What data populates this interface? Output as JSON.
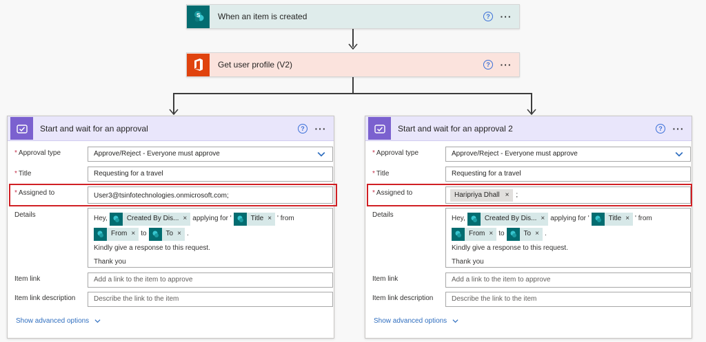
{
  "trigger": {
    "title": "When an item is created",
    "icon": "sharepoint-icon",
    "bg": "#dfeceb"
  },
  "profile": {
    "title": "Get user profile (V2)",
    "icon": "office-icon",
    "bg": "#fbe3dd"
  },
  "common": {
    "help": "?",
    "more": "···"
  },
  "left": {
    "title": "Start and wait for an approval",
    "approval_type_label": "Approval type",
    "approval_type_value": "Approve/Reject - Everyone must approve",
    "title_label": "Title",
    "title_value": "Requesting for a travel",
    "assigned_label": "Assigned to",
    "assigned_value": "User3@tsinfotechnologies.onmicrosoft.com;",
    "details_label": "Details",
    "item_link_label": "Item link",
    "item_link_placeholder": "Add a link to the item to approve",
    "item_link_desc_label": "Item link description",
    "item_link_desc_placeholder": "Describe the link to the item",
    "advanced": "Show advanced options"
  },
  "right": {
    "title": "Start and wait for an approval 2",
    "approval_type_label": "Approval type",
    "approval_type_value": "Approve/Reject - Everyone must approve",
    "title_label": "Title",
    "title_value": "Requesting for a travel",
    "assigned_label": "Assigned to",
    "assigned_person": "Haripriya Dhall",
    "assigned_suffix": ";",
    "details_label": "Details",
    "item_link_label": "Item link",
    "item_link_placeholder": "Add a link to the item to approve",
    "item_link_desc_label": "Item link description",
    "item_link_desc_placeholder": "Describe the link to the item",
    "advanced": "Show advanced options"
  },
  "details": {
    "hey": "Hey,",
    "token_created_by": "Created By Dis...",
    "applying_for": "applying for '",
    "token_title": "Title",
    "from_text": "' from",
    "token_from": "From",
    "to_text": "to",
    "token_to": "To",
    "period": ".",
    "line3": "Kindly give a response to this request.",
    "line4": "Thank you",
    "close": "×"
  },
  "colors": {
    "required": "#c4314b",
    "highlight": "#d01f24",
    "accent": "#2f6ebf",
    "approval_header": "#e9e6fb"
  }
}
